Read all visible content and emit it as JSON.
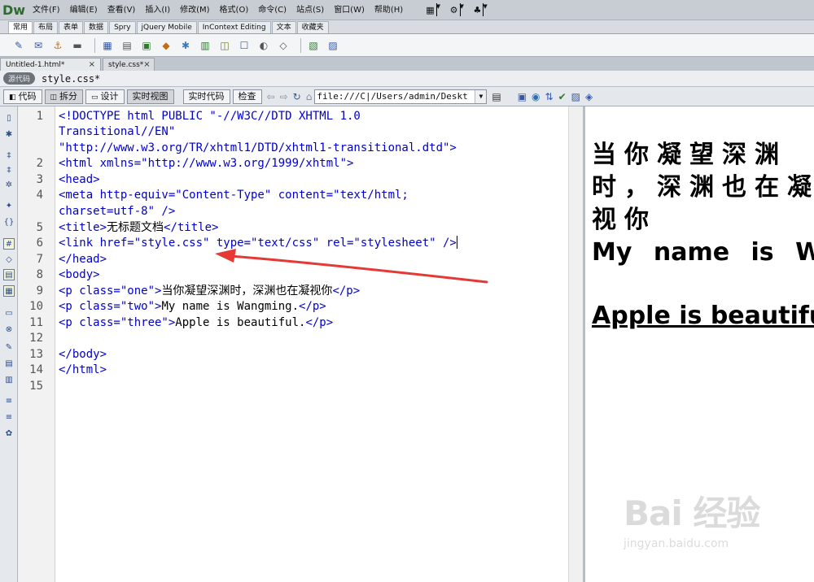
{
  "app": {
    "logo": "Dw"
  },
  "menu": [
    "文件(F)",
    "编辑(E)",
    "查看(V)",
    "插入(I)",
    "修改(M)",
    "格式(O)",
    "命令(C)",
    "站点(S)",
    "窗口(W)",
    "帮助(H)"
  ],
  "menu_tools": [
    "layout-icon",
    "gear-icon",
    "site-icon"
  ],
  "insert_tabs": [
    "常用",
    "布局",
    "表单",
    "数据",
    "Spry",
    "jQuery Mobile",
    "InContext Editing",
    "文本",
    "收藏夹"
  ],
  "doc_tabs": [
    {
      "name": "Untitled-1.html*",
      "active": true
    },
    {
      "name": "style.css*",
      "active": false
    }
  ],
  "related": {
    "source_label": "源代码",
    "file": "style.css*"
  },
  "view_buttons": [
    "代码",
    "拆分",
    "设计",
    "实时视图"
  ],
  "live_buttons": [
    "实时代码",
    "检查"
  ],
  "address": "file:///C|/Users/admin/Deskt",
  "code": {
    "line_numbers": [
      "1",
      "2",
      "3",
      "4",
      "5",
      "6",
      "7",
      "8",
      "9",
      "10",
      "11",
      "12",
      "13",
      "14",
      "15"
    ],
    "lines": [
      "<!DOCTYPE html PUBLIC \"-//W3C//DTD XHTML 1.0",
      "Transitional//EN\"",
      "\"http://www.w3.org/TR/xhtml1/DTD/xhtml1-transitional.dtd\">",
      "<html xmlns=\"http://www.w3.org/1999/xhtml\">",
      "<head>",
      "<meta http-equiv=\"Content-Type\" content=\"text/html;",
      "charset=utf-8\" />",
      "<title>",
      "无标题文档",
      "</title>",
      "<link href=\"style.css\" type=\"text/css\" rel=\"stylesheet\" />",
      "</head>",
      "<body>",
      "<p class=\"one\">",
      "当你凝望深渊时，深渊也在凝视你",
      "</p>",
      "<p class=\"two\">",
      "My name is Wangming.",
      "</p>",
      "<p class=\"three\">",
      "Apple is beautiful.",
      "</p>",
      "</body>",
      "</html>"
    ]
  },
  "preview": {
    "p1": "当你凝望深渊时，深渊也在凝视你",
    "p2": "My name is Wangming.",
    "p3": "Apple is beautiful."
  },
  "colors": {
    "code_tag": "#0000cc",
    "annotation_arrow": "#e53935"
  },
  "watermark": {
    "main": "Bai 经验",
    "sub": "jingyan.baidu.com"
  }
}
